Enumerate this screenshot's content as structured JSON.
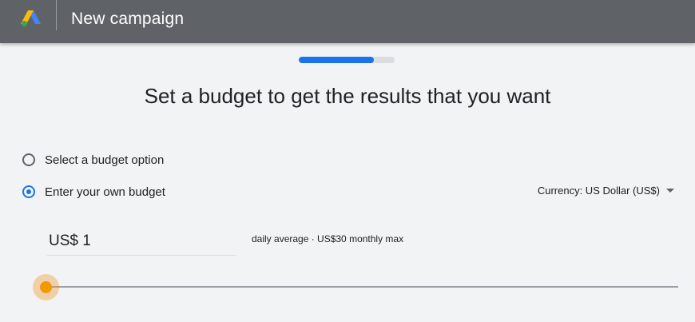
{
  "header": {
    "title": "New campaign",
    "logo_icon": "google-ads-logo-icon",
    "background_color": "#5f6368"
  },
  "progress": {
    "fraction": 0.78,
    "color": "#1a73e8"
  },
  "main": {
    "heading": "Set a budget to get the results that you want",
    "options": [
      {
        "label": "Select a budget option",
        "checked": false
      },
      {
        "label": "Enter your own budget",
        "checked": true
      }
    ],
    "currency": {
      "label": "Currency: US Dollar (US$)",
      "icon": "dropdown-caret-icon"
    },
    "budget": {
      "value": "US$ 1",
      "hint": "daily average · US$30 monthly max"
    },
    "slider": {
      "value_fraction": 0.0,
      "color": "#f29900"
    }
  }
}
